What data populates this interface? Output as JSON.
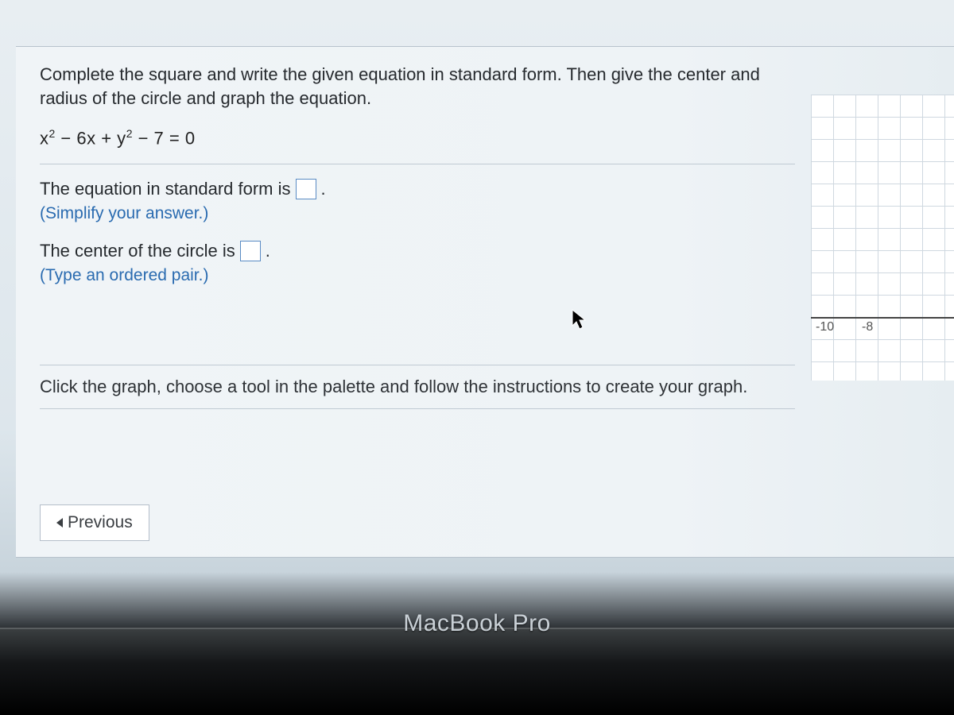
{
  "question": {
    "instruction": "Complete the square and write the given equation in standard form. Then give the center and radius of the circle and graph the equation.",
    "equation_plain": "x^2 - 6x + y^2 - 7 = 0",
    "prompt_standard_pre": "The equation in standard form is",
    "prompt_standard_post": ".",
    "hint_standard": "(Simplify your answer.)",
    "prompt_center_pre": "The center of the circle is",
    "prompt_center_post": ".",
    "hint_center": "(Type an ordered pair.)",
    "graph_instruction": "Click the graph, choose a tool in the palette and follow the instructions to create your graph."
  },
  "graph": {
    "tick_neg10": "-10",
    "tick_neg8": "-8"
  },
  "nav": {
    "previous_label": "Previous"
  },
  "device": {
    "label": "MacBook Pro"
  }
}
